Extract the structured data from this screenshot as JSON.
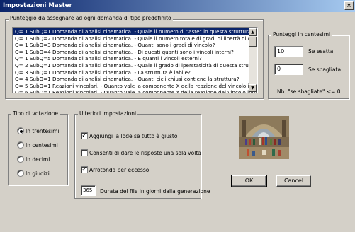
{
  "window": {
    "title": "Impostazioni Master"
  },
  "question_group": {
    "label": "Punteggio da assegnare ad ogni domanda di tipo predefinito",
    "items": [
      "Q= 1 SubQ=1 Domanda di analisi cinematica.  - Quale il numero di \"aste\" in questa struttura?",
      "Q= 1 SubQ=2 Domanda di analisi cinematica.  - Quale il numero totale di gradi di libertà di queste aste?",
      "Q= 1 SubQ=3 Domanda di analisi cinematica.  - Quanti sono i gradi di vincolo?",
      "Q= 1 SubQ=4 Domanda di analisi cinematica.  - Di questi quanti sono i vincoli interni?",
      "Q= 1 SubQ=5 Domanda di analisi cinematica.  - E quanti i vincoli esterni?",
      "Q= 2 SubQ=1 Domanda di analisi cinematica.  - Quale il grado di iperstaticità di questa struttura?",
      "Q= 3 SubQ=1 Domanda di analisi cinematica.  - La struttura è labile?",
      "Q= 4 SubQ=1 Domanda di analisi cinematica.  - Quanti cicli chiusi contiene la struttura?",
      "Q= 5 SubQ=1 Reazioni vincolari.  - Quanto vale la componente X della reazione del vincolo indicato?",
      "Q= 6 SubQ=1 Reazioni vincolari.  - Quanto vale la componente Y della reazione del vincolo indicato?"
    ]
  },
  "score_group": {
    "label": "Punteggi in centesimi",
    "correct_value": "10",
    "correct_label": "Se esatta",
    "wrong_value": "0",
    "wrong_label": "Se sbagliata",
    "note": "Nb: \"se sbagliate\" <= 0"
  },
  "vote_group": {
    "label": "Tipo di votazione",
    "options": [
      "In trentesimi",
      "In centesimi",
      "In decimi",
      "In giudizi"
    ],
    "selected": "In trentesimi"
  },
  "other_group": {
    "label": "Ulteriori impostazioni",
    "check_praise": {
      "label": "Aggiungi la lode se tutto è giusto",
      "checked": true
    },
    "check_once": {
      "label": "Consenti di dare le risposte una sola volta",
      "checked": false
    },
    "check_round": {
      "label": "Arrotonda per eccesso",
      "checked": true
    },
    "duration_value": "365",
    "duration_label": "Durata del file in giorni dalla generazione"
  },
  "buttons": {
    "ok": "OK",
    "cancel": "Cancel"
  },
  "colors": {
    "selection": "#0a246a",
    "face": "#d4d0c8"
  }
}
